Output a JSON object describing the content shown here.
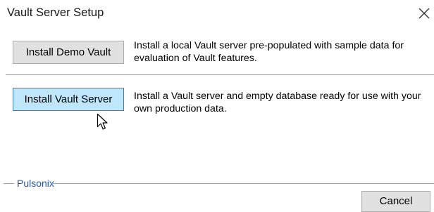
{
  "window": {
    "title": "Vault Server Setup"
  },
  "options": {
    "demo": {
      "button_label": "Install Demo Vault",
      "description": "Install a local Vault server pre-populated with sample data for evaluation of Vault features."
    },
    "server": {
      "button_label": "Install Vault Server",
      "description": "Install a Vault server and empty database ready for use with your own production data."
    }
  },
  "footer": {
    "group_label": "Pulsonix",
    "cancel_label": "Cancel"
  },
  "icons": {
    "close": "close-icon",
    "cursor": "mouse-pointer-icon"
  },
  "colors": {
    "selected_button_bg": "#bee6fd",
    "selected_button_border": "#3c7fb1",
    "button_bg": "#e1e1e1",
    "group_label": "#1e5aa8"
  }
}
